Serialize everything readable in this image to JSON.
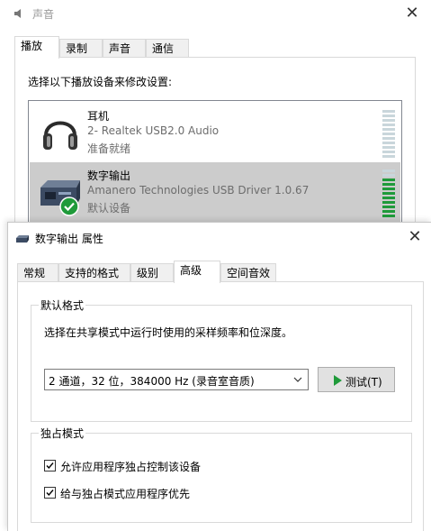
{
  "sound_window": {
    "title": "声音",
    "close_glyph": "✕",
    "tabs": [
      {
        "label": "播放",
        "active": true
      },
      {
        "label": "录制",
        "active": false
      },
      {
        "label": "声音",
        "active": false
      },
      {
        "label": "通信",
        "active": false
      }
    ],
    "instruction": "选择以下播放设备来修改设置:",
    "devices": [
      {
        "name": "耳机",
        "description": "2- Realtek USB2.0 Audio",
        "status": "准备就绪",
        "icon": "headphones-icon",
        "selected": false,
        "level_fraction": 0
      },
      {
        "name": "数字输出",
        "description": "Amanero Technologies USB Driver 1.0.67",
        "status": "默认设备",
        "icon": "digital-output-icon",
        "default_badge_icon": "default-check-icon",
        "selected": true,
        "level_fraction": 0.8
      }
    ]
  },
  "props_window": {
    "title": "数字输出 属性",
    "close_glyph": "✕",
    "tabs": [
      {
        "label": "常规",
        "active": false
      },
      {
        "label": "支持的格式",
        "active": false
      },
      {
        "label": "级别",
        "active": false
      },
      {
        "label": "高级",
        "active": true
      },
      {
        "label": "空间音效",
        "active": false
      }
    ],
    "default_format": {
      "legend": "默认格式",
      "description": "选择在共享模式中运行时使用的采样频率和位深度。",
      "selected_format": "2 通道，32 位，384000 Hz (录音室音质)",
      "test_button": "测试(T)"
    },
    "exclusive_mode": {
      "legend": "独占模式",
      "options": [
        {
          "label": "允许应用程序独占控制该设备",
          "checked": true
        },
        {
          "label": "给与独占模式应用程序优先",
          "checked": true
        }
      ]
    }
  },
  "colors": {
    "selection": "#cccccc",
    "level_on": "#1f9a3a",
    "level_off": "#c9d6db",
    "check_badge": "#1f9a3a",
    "play_icon": "#1f9a3a"
  }
}
